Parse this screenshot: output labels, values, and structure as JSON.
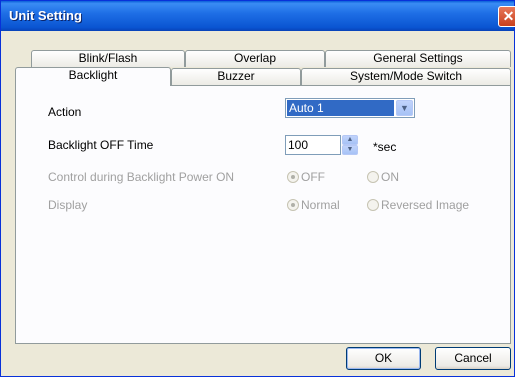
{
  "window": {
    "title": "Unit Setting",
    "close_glyph": "✕"
  },
  "tabs_back": [
    "Blink/Flash",
    "Overlap",
    "General Settings"
  ],
  "tabs_front": [
    "Backlight",
    "Buzzer",
    "System/Mode Switch"
  ],
  "active_tab": "Backlight",
  "form": {
    "action_label": "Action",
    "action_value": "Auto 1",
    "backlight_off_label": "Backlight OFF Time",
    "backlight_off_value": "100",
    "unit": "*sec",
    "control_label": "Control during Backlight Power ON",
    "control_options": [
      "OFF",
      "ON"
    ],
    "control_selected": "OFF",
    "display_label": "Display",
    "display_options": [
      "Normal",
      "Reversed Image"
    ],
    "display_selected": "Normal"
  },
  "buttons": {
    "ok": "OK",
    "cancel": "Cancel"
  },
  "icons": {
    "dropdown": "chevron-down-icon",
    "spin_up": "triangle-up-icon",
    "spin_down": "triangle-down-icon"
  },
  "colors": {
    "titlebar": "#0a55d2",
    "selection": "#316ac5",
    "dialog": "#ece9d8"
  }
}
